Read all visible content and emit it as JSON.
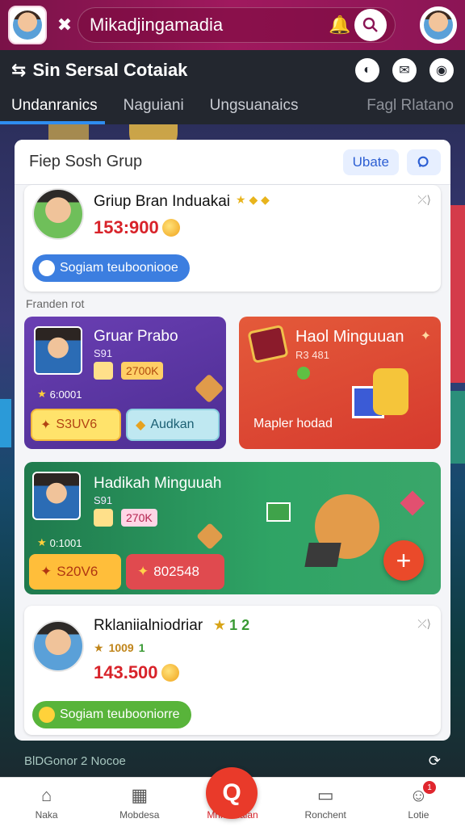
{
  "topbar": {
    "title": "Mikadjingamadia"
  },
  "subbar": {
    "brand": "Sin Sersal Cotaiak",
    "tabs": [
      {
        "label": "Undanranics"
      },
      {
        "label": "Naguiani"
      },
      {
        "label": "Ungsuanaics"
      },
      {
        "label": "Fagl Rlatano"
      }
    ]
  },
  "panel": {
    "title": "Fiep Sosh Grup",
    "update_label": "Ubate",
    "card1": {
      "name": "Griup Bran Induakai",
      "amount": "153:900",
      "action": "Sogiam teubooniooe"
    },
    "section_label": "Franden rot",
    "purple": {
      "title": "Gruar Prabo",
      "sub": "S91",
      "value": "2700K",
      "stat": "6:0001",
      "btn1": "S3UV6",
      "btn2": "Audkan"
    },
    "red": {
      "title": "Haol Minguuan",
      "sub": "R3 481",
      "footer": "Mapler hodad"
    },
    "green": {
      "title": "Hadikah Minguuah",
      "sub": "S91",
      "value": "270K",
      "stat": "0:1001",
      "btn1": "S20V6",
      "btn2": "802548"
    },
    "card2": {
      "name": "Rklaniialniodriar",
      "stars": "1 2",
      "rating": "1009",
      "rating2": "1",
      "amount": "143.500",
      "action": "Sogiam teubooniorre"
    }
  },
  "footer_strip": {
    "label": "BlDGonor 2 Nocoe"
  },
  "nav": [
    {
      "label": "Naka",
      "icon": "home-icon"
    },
    {
      "label": "Mobdesa",
      "icon": "calendar-icon"
    },
    {
      "label": "Mhkidcialan",
      "icon": "chat-icon"
    },
    {
      "label": "Ronchent",
      "icon": "monitor-icon"
    },
    {
      "label": "Lotie",
      "icon": "user-icon",
      "badge": "1"
    }
  ],
  "colors": {
    "topbar": "#a0195e",
    "accent_red": "#e93a2a",
    "tab_underline": "#2f8df0"
  }
}
